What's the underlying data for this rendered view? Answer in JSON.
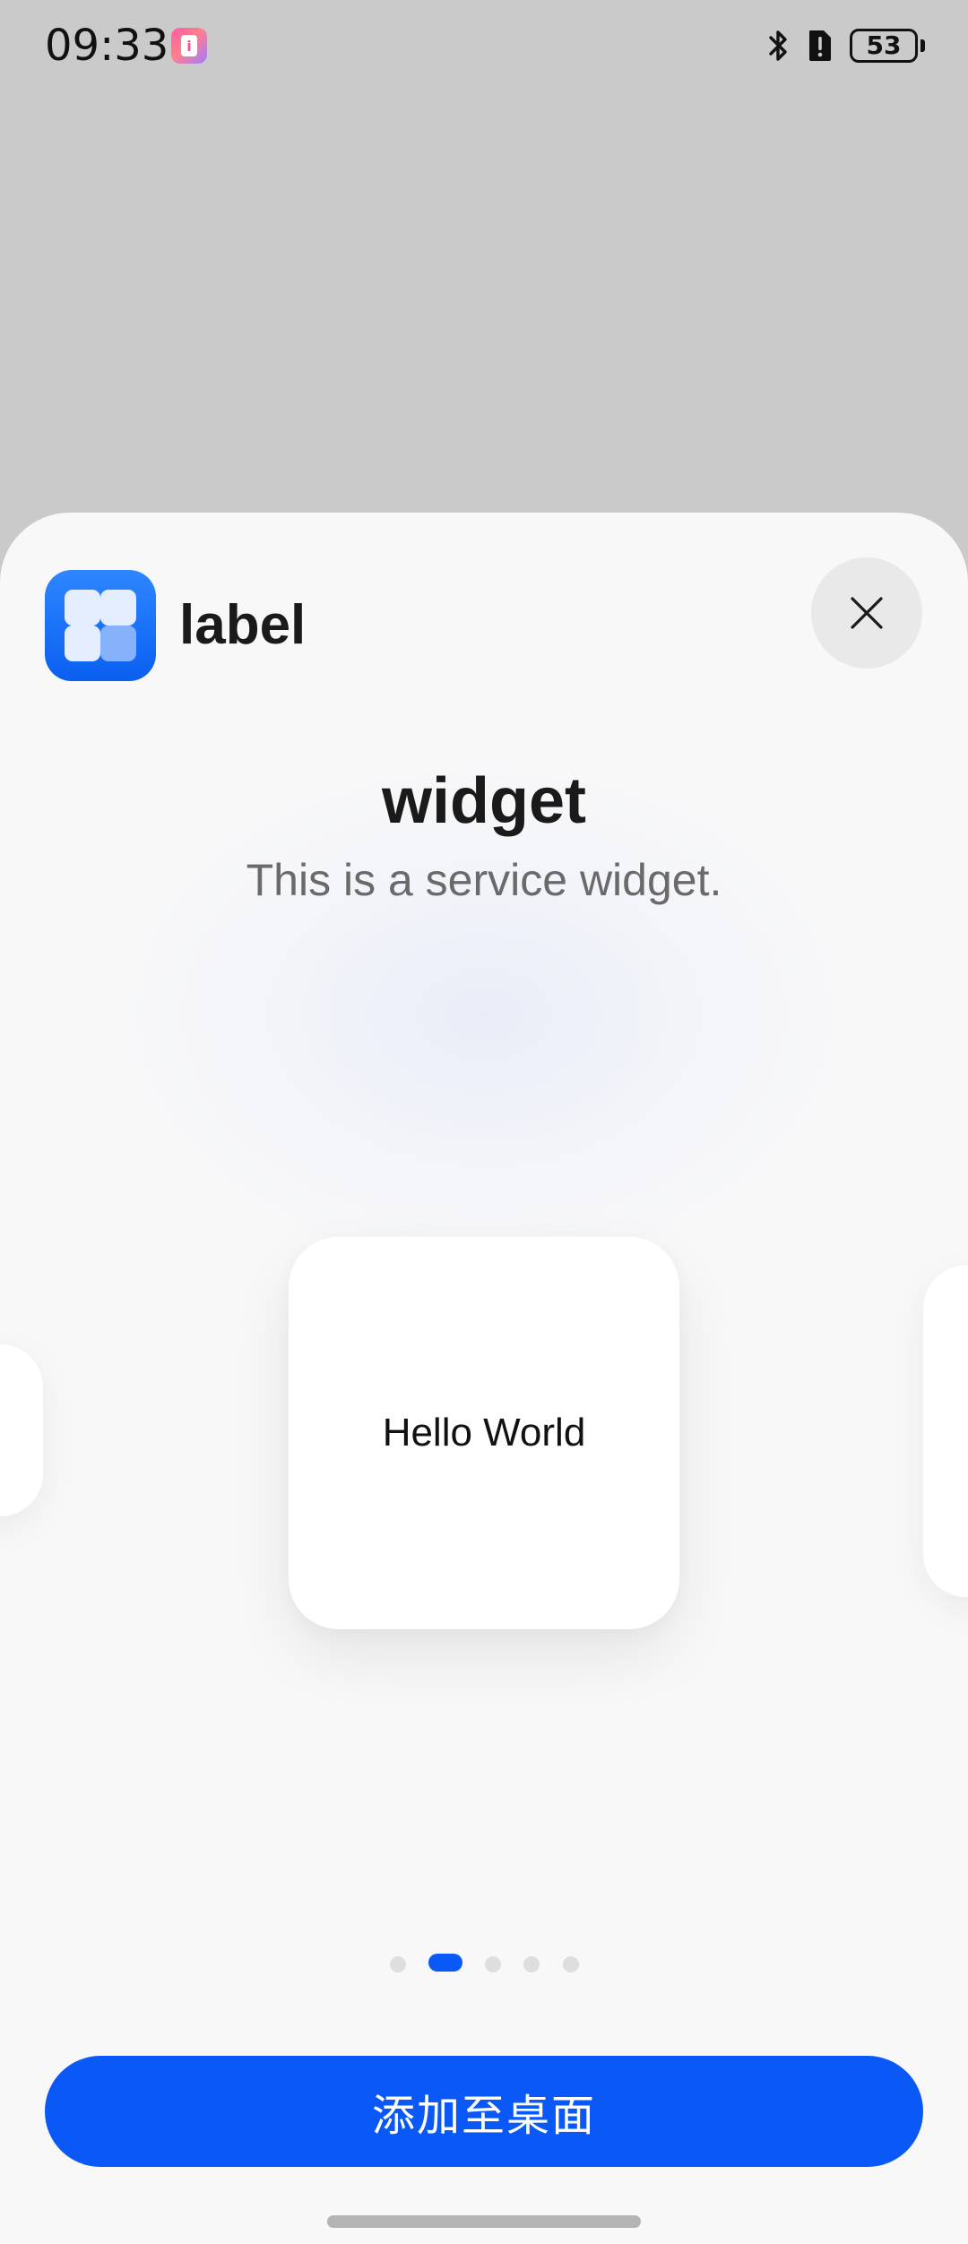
{
  "status_bar": {
    "time": "09:33",
    "app_notification_icon": "app-notification-icon",
    "app_icon_glyph": "i",
    "bluetooth_icon": "bluetooth-icon",
    "alert_icon": "sim-alert-icon",
    "battery_level": "53",
    "battery_fraction": 0.53
  },
  "sheet": {
    "app": {
      "icon": "grid-app-icon",
      "label": "label"
    },
    "close_icon": "close-icon",
    "widget": {
      "title": "widget",
      "description": "This is a service widget.",
      "card_text": "Hello World"
    },
    "pager": {
      "count": 5,
      "active_index": 1
    },
    "add_button_label": "添加至桌面"
  },
  "colors": {
    "accent": "#0a59f7",
    "sheet_background": "#f8f8f9",
    "backdrop": "#cacaca"
  }
}
